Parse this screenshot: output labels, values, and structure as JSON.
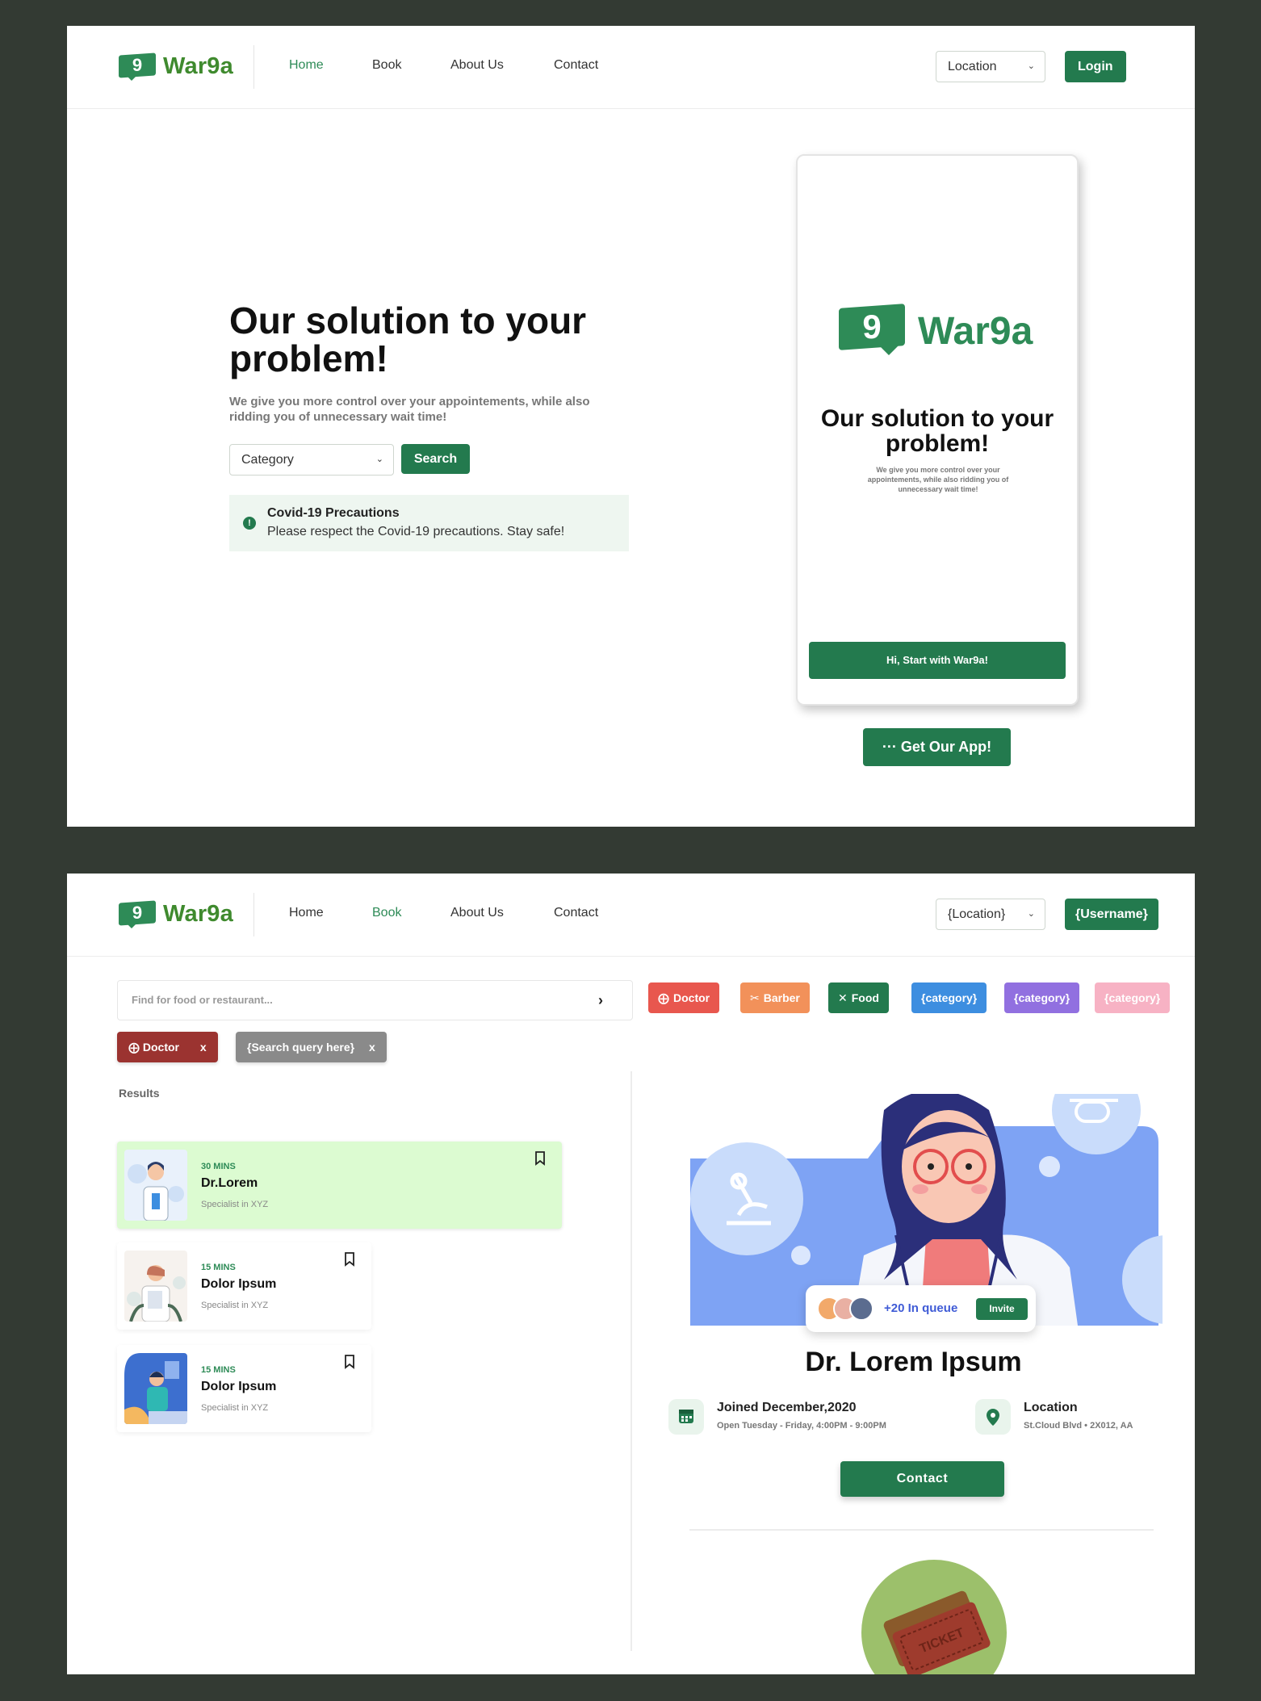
{
  "brand": {
    "logo_digit": "9",
    "name": "War9a",
    "accent": "#237a4e"
  },
  "screen1": {
    "nav": {
      "links": [
        "Home",
        "Book",
        "About Us",
        "Contact"
      ],
      "active": "Home",
      "location_select": "Location",
      "login_label": "Login"
    },
    "hero": {
      "title": "Our solution to your problem!",
      "subtitle": "We give you more control over your appointements, while also ridding you of unnecessary wait time!",
      "category_select": "Category",
      "search_label": "Search"
    },
    "notice": {
      "title": "Covid-19 Precautions",
      "body": "Please respect the Covid-19 precautions. Stay safe!"
    },
    "phone": {
      "brand": "War9a",
      "title": "Our solution to your problem!",
      "subtitle": "We give you more control over your appointements, while also ridding you of unnecessary wait time!",
      "cta": "Hi, Start with War9a!"
    },
    "get_app_label": "··· Get Our App!"
  },
  "screen2": {
    "nav": {
      "links": [
        "Home",
        "Book",
        "About Us",
        "Contact"
      ],
      "active": "Book",
      "location_select": "{Location}",
      "user_label": "{Username}"
    },
    "search": {
      "placeholder": "Find for food or restaurant..."
    },
    "categories": [
      {
        "label": "Doctor",
        "color": "#e8574e",
        "icon": "doctor-icon"
      },
      {
        "label": "Barber",
        "color": "#f2915a",
        "icon": "scissors-icon"
      },
      {
        "label": "Food",
        "color": "#237a4e",
        "icon": "utensils-icon"
      },
      {
        "label": "{category}",
        "color": "#3d8ee0",
        "icon": ""
      },
      {
        "label": "{category}",
        "color": "#9170e0",
        "icon": ""
      },
      {
        "label": "{category}",
        "color": "#f7b2c4",
        "icon": ""
      }
    ],
    "active_filters": [
      {
        "label": "Doctor",
        "remove": "x",
        "color": "#9b3330"
      },
      {
        "label": "{Search query here}",
        "remove": "x",
        "color": "#8a8a8a"
      }
    ],
    "results_label": "Results",
    "results": [
      {
        "mins": "30 MINS",
        "name": "Dr.Lorem",
        "specialty": "Specialist in XYZ"
      },
      {
        "mins": "15 MINS",
        "name": "Dolor Ipsum",
        "specialty": "Specialist in XYZ"
      },
      {
        "mins": "15 MINS",
        "name": "Dolor Ipsum",
        "specialty": "Specialist in XYZ"
      }
    ],
    "detail": {
      "queue_text": "+20 In queue",
      "invite_label": "Invite",
      "name": "Dr. Lorem Ipsum",
      "joined_title": "Joined December,2020",
      "joined_sub": "Open Tuesday - Friday, 4:00PM - 9:00PM",
      "location_title": "Location",
      "location_sub": "St.Cloud Blvd • 2X012, AA",
      "contact_label": "Contact",
      "ticket_text": "TICKET"
    }
  }
}
